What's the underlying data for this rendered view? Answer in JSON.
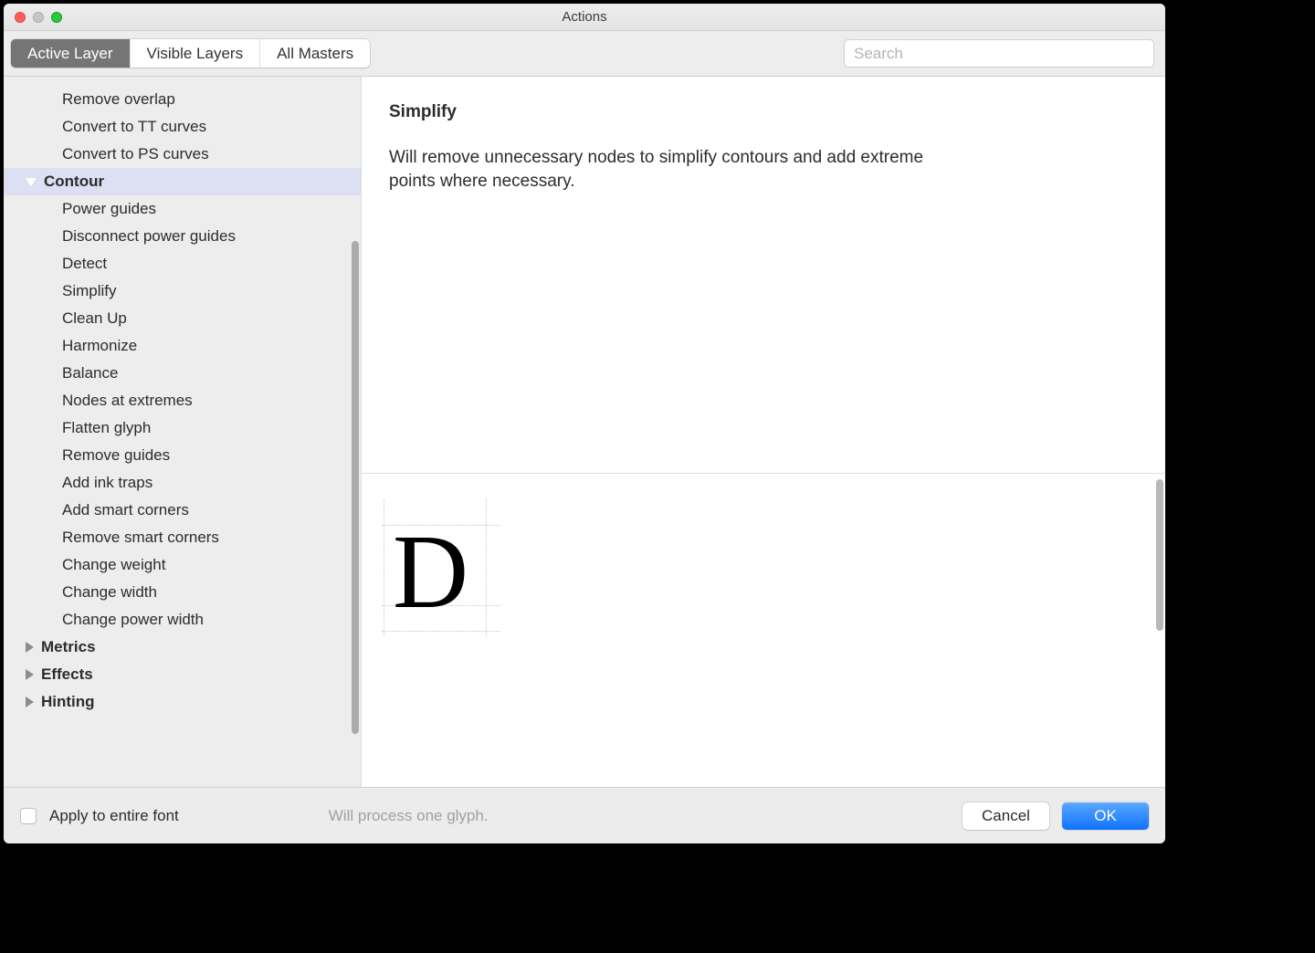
{
  "window": {
    "title": "Actions"
  },
  "toolbar": {
    "segments": [
      "Active Layer",
      "Visible Layers",
      "All Masters"
    ],
    "active_index": 0,
    "search_placeholder": "Search"
  },
  "sidebar": {
    "pre_items": [
      "Remove overlap",
      "Convert to TT curves",
      "Convert to PS curves"
    ],
    "selected_category": "Contour",
    "contour_items": [
      "Power guides",
      "Disconnect power guides",
      "Detect",
      "Simplify",
      "Clean Up",
      "Harmonize",
      "Balance",
      "Nodes at extremes",
      "Flatten glyph",
      "Remove guides",
      "Add ink traps",
      "Add smart corners",
      "Remove smart corners",
      "Change weight",
      "Change width",
      "Change power width"
    ],
    "post_categories": [
      "Metrics",
      "Effects",
      "Hinting"
    ]
  },
  "detail": {
    "title": "Simplify",
    "description": "Will remove unnecessary nodes to simplify contours and add extreme points where necessary.",
    "preview_glyph": "D"
  },
  "footer": {
    "checkbox_label": "Apply to entire font",
    "status": "Will process one glyph.",
    "cancel": "Cancel",
    "ok": "OK"
  }
}
